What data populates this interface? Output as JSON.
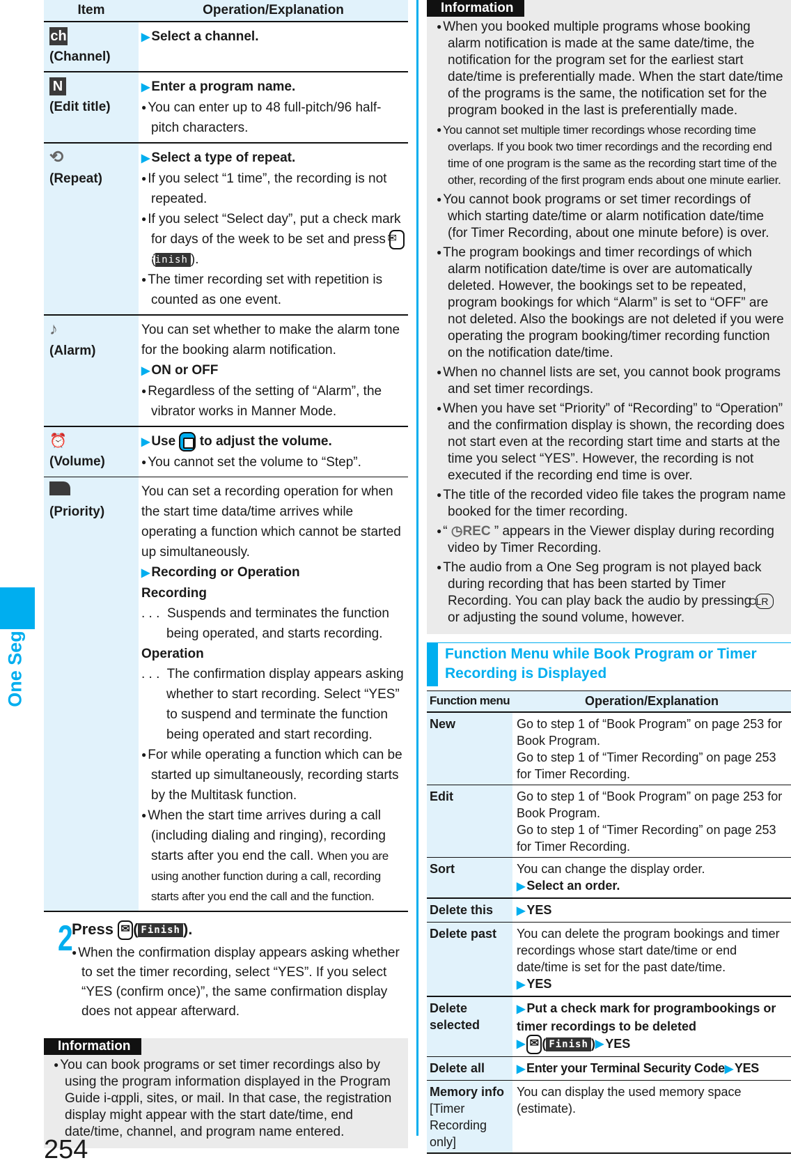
{
  "side_tab": {
    "label": "One Seg"
  },
  "page_number": "254",
  "left_table": {
    "headers": {
      "item": "Item",
      "operation": "Operation/Explanation"
    },
    "rows": [
      {
        "icon": "ch",
        "label": "(Channel)",
        "step": "Select a channel."
      },
      {
        "icon": "N",
        "label": "(Edit title)",
        "step": "Enter a program name.",
        "bullets": [
          "You can enter up to 48 full-pitch/96 half-pitch characters."
        ]
      },
      {
        "icon": "repeat-icon",
        "label": "(Repeat)",
        "step": "Select a type of repeat.",
        "bullets": [
          "If you select “1 time”, the recording is not repeated.",
          "If you select “Select day”, put a check mark for days of the week to be set and press",
          "The timer recording set with repetition is counted as one event."
        ],
        "finish_key": "Finish"
      },
      {
        "icon": "note-icon",
        "label": "(Alarm)",
        "intro": "You can set whether to make the alarm tone for the booking alarm notification.",
        "step": "ON or OFF",
        "bullets": [
          "Regardless of the setting of “Alarm”, the vibrator works in Manner Mode."
        ]
      },
      {
        "icon": "alarm-clock-icon",
        "label": "(Volume)",
        "step_pre": "Use",
        "step_post": "to adjust the volume.",
        "bullets": [
          "You cannot set the volume to “Step”."
        ]
      },
      {
        "icon": "priority-icon",
        "label": "(Priority)",
        "intro": "You can set a recording operation for when the start time data/time arrives while operating a function which cannot be started up simultaneously.",
        "step": "Recording or Operation",
        "options": [
          {
            "name": "Recording",
            "desc": "Suspends and terminates the function being operated, and starts recording."
          },
          {
            "name": "Operation",
            "desc": "The confirmation display appears asking whether to start recording. Select “YES” to suspend and terminate the function being operated and start recording."
          }
        ],
        "bullets": [
          "For while operating a function which can be started up simultaneously, recording starts by the Multitask function.",
          "When the start time arrives during a call (including dialing and ringing), recording starts after you end the call.",
          "When you are using another function during a call, recording starts after you end the call and the function."
        ]
      }
    ]
  },
  "step2": {
    "number": "2",
    "title_pre": "Press",
    "finish_key": "Finish",
    "text": "When the confirmation display appears asking whether to set the timer recording, select “YES”. If you select “YES (confirm once)”, the same confirmation display does not appear afterward."
  },
  "info_left": {
    "tag": "Information",
    "bullets": [
      "You can book programs or set timer recordings also by using the program information displayed in the Program Guide i-αppli, sites, or mail. In that case, the registration display might appear with the start date/time, end date/time, channel, and program name entered."
    ]
  },
  "info_right": {
    "tag": "Information",
    "bullets": [
      "When you booked multiple programs whose booking alarm notification is made at the same date/time, the notification for the program set for the earliest start date/time is preferentially made. When the start date/time of the programs is the same, the notification set for the program booked in the last is preferentially made.",
      "You cannot set multiple timer recordings whose recording time overlaps. If you book two timer recordings and the recording end time of one program is the same as the recording start time of the other, recording of the first program ends about one minute earlier.",
      "You cannot book programs or set timer recordings of which starting date/time or alarm notification date/time (for Timer Recording, about one minute before) is over.",
      "The program bookings and timer recordings of which alarm notification date/time is over are automatically deleted. However, the bookings set to be repeated, program bookings for which “Alarm” is set to “OFF” are not deleted. Also the bookings are not deleted if you were operating the program booking/timer recording function on the notification date/time.",
      "When no channel lists are set, you cannot book programs and set timer recordings.",
      "When you have set “Priority” of “Recording” to “Operation” and the confirmation display is shown, the recording does not start even at the recording start time and starts at the time you select “YES”. However, the recording is not executed if the recording end time is over.",
      "The title of the recorded video file takes the program name booked for the timer recording."
    ],
    "rec_bullet": {
      "pre": "“",
      "icon_text": "REC",
      "post": "” appears in the Viewer display during recording video by Timer Recording."
    },
    "clr_bullet": {
      "pre": "The audio from a One Seg program is not played back during recording that has been started by Timer Recording. You can play back the audio by pressing",
      "key": "CLR",
      "post": "or adjusting the sound volume, however."
    }
  },
  "function_menu": {
    "title": "Function Menu while Book Program or Timer Recording is Displayed",
    "headers": {
      "fn": "Function menu",
      "operation": "Operation/Explanation"
    },
    "rows": [
      {
        "name": "New",
        "text": [
          "Go to step 1 of “Book Program” on page 253 for Book Program.",
          "Go to step 1 of “Timer Recording” on page 253 for Timer Recording."
        ]
      },
      {
        "name": "Edit",
        "text": [
          "Go to step 1 of “Book Program” on page 253 for Book Program.",
          "Go to step 1 of “Timer Recording” on page 253 for Timer Recording."
        ]
      },
      {
        "name": "Sort",
        "text": [
          "You can change the display order."
        ],
        "step": "Select an order."
      },
      {
        "name": "Delete this",
        "step": "YES"
      },
      {
        "name": "Delete past",
        "text": [
          "You can delete the program bookings and timer recordings whose start date/time or end date/time is set for the past date/time."
        ],
        "step": "YES"
      },
      {
        "name": "Delete selected",
        "step": "Put a check mark for programbookings or timer recordings to be deleted",
        "finish_key": "Finish",
        "step_end": "YES"
      },
      {
        "name": "Delete all",
        "step": "Enter your Terminal Security Code",
        "step_end": "YES"
      },
      {
        "name": "Memory info",
        "note": "[Timer Recording only]",
        "text": [
          "You can display the used memory space (estimate)."
        ]
      }
    ]
  },
  "colors": {
    "accent": "#00aeef",
    "header_bg": "#e1f2fb",
    "info_bg": "#ebebeb"
  }
}
